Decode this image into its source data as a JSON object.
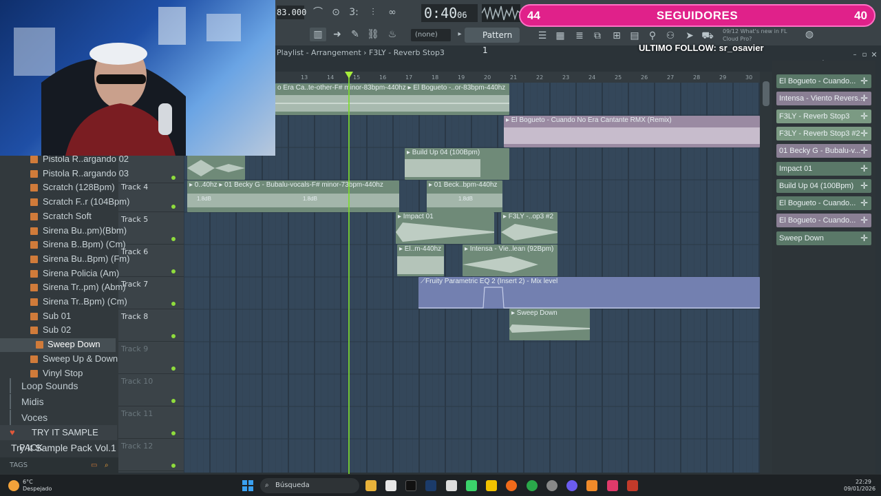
{
  "toolbar": {
    "bpm": "83.000",
    "time": "0:40",
    "time_sub": "06",
    "pattern": "Pattern 1",
    "none_select": "(none)",
    "news_date": "09/12",
    "news_text": "What's new in FL Cloud Pro?"
  },
  "overlay": {
    "followers_left": "44",
    "followers_title": "SEGUIDORES",
    "followers_right": "40",
    "last_follow": "ULTIMO FOLLOW: sr_osavier"
  },
  "playlist": {
    "title": "Playlist - Arrangement › F3LY - Reverb Stop3"
  },
  "ruler": [
    "13",
    "14",
    "15",
    "16",
    "17",
    "18",
    "19",
    "20",
    "21",
    "22",
    "23",
    "24",
    "25",
    "26",
    "27",
    "28",
    "29",
    "30"
  ],
  "browser": {
    "items": [
      "Pistola R..argando 02",
      "Pistola R..argando 03",
      "Scratch (128Bpm)",
      "Scratch F..r (104Bpm)",
      "Scratch Soft",
      "Sirena Bu..pm)(Bbm)",
      "Sirena B..Bpm) (Cm)",
      "Sirena Bu..Bpm) (Fm)",
      "Sirena Policia (Am)",
      "Sirena Tr..pm) (Abm)",
      "Sirena Tr..Bpm) (Cm)",
      "Sub 01",
      "Sub 02",
      "Sweep Down",
      "Sweep Up & Down",
      "Vinyl Stop"
    ],
    "folders": [
      "Loop Sounds",
      "Midis",
      "Voces"
    ],
    "pack_header": "TRY IT SAMPLE PACK",
    "pack": "Try It Sample Pack Vol.1",
    "tags": "TAGS"
  },
  "tracks": [
    "Track 4",
    "Track 5",
    "Track 6",
    "Track 7",
    "Track 8",
    "Track 9",
    "Track 10",
    "Track 11",
    "Track 12"
  ],
  "clips": {
    "c1": "o Era Ca..te-other-F# minor-83bpm-440hz ▸ El Bogueto -..or-83bpm-440hz",
    "c2": "▸ El Bogueto - Cuando No Era Cantante RMX (Remix)",
    "c3": "▸ Build Up 04 (100Bpm)",
    "c4": "▸ 0..40hz ▸ 01 Becky G - Bubalu-vocals-F# minor-73bpm-440hz",
    "c4_db1": "1.8dB",
    "c4_db2": "1.8dB",
    "c5": "▸ 01 Beck..bpm-440hz",
    "c5_db": "1.8dB",
    "c6": "▸ Impact 01",
    "c7": "▸ F3LY -..op3 #2",
    "c8": "▸ El..m-440hz",
    "c9": "▸ Intensa - Vie..lean (92Bpm)",
    "c10": "⟋Fruity Parametric EQ 2 (Insert 2) - Mix level",
    "c11": "▸ Sweep Down"
  },
  "picker": [
    "El Bogueto - Cuando...",
    "Intensa - Viento Revers...",
    "F3LY - Reverb Stop3",
    "F3LY - Reverb Stop3 #2",
    "01 Becky G - Bubalu-v...",
    "Impact 01",
    "Build Up 04 (100Bpm)",
    "El Bogueto - Cuando...",
    "El Bogueto - Cuando...",
    "Sweep Down"
  ],
  "taskbar": {
    "temp": "6°C",
    "weather": "Despejado",
    "search": "Búsqueda",
    "time": "22:29",
    "date": "09/01/2026"
  },
  "colors": {
    "accent": "#e0218a",
    "clip_green": "#6f8a78",
    "clip_pink": "#9a8aa2",
    "automation": "#7380b0",
    "playhead": "#7ddc2f"
  }
}
